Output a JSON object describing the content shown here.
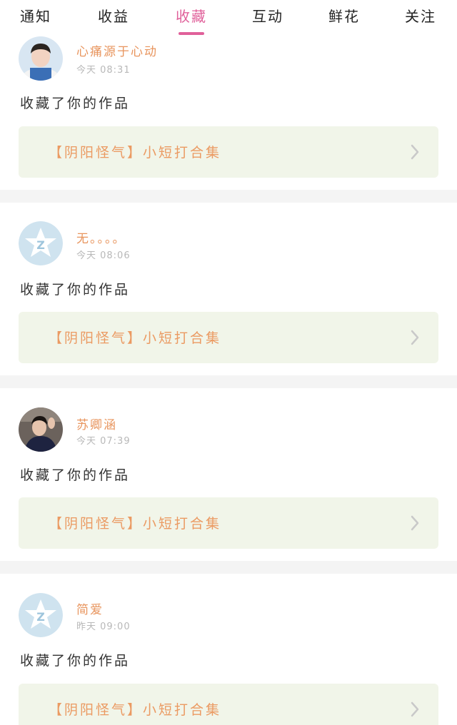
{
  "tabs": [
    {
      "label": "通知",
      "active": false
    },
    {
      "label": "收益",
      "active": false
    },
    {
      "label": "收藏",
      "active": true
    },
    {
      "label": "互动",
      "active": false
    },
    {
      "label": "鲜花",
      "active": false
    },
    {
      "label": "关注",
      "active": false
    }
  ],
  "colors": {
    "active_tab": "#e0609a",
    "username": "#e8955e",
    "work_title": "#eb9a62",
    "work_box_bg": "#f1f5e9",
    "default_avatar_bg": "#cfe3ef"
  },
  "notifications": [
    {
      "username": "心痛源于心动",
      "time": "今天 08:31",
      "avatar": "photo-avatar-boy",
      "action": "收藏了你的作品",
      "work_title": "【阴阳怪气】小短打合集"
    },
    {
      "username": "无。。。。",
      "time": "今天 08:06",
      "avatar": "default-star-avatar",
      "action": "收藏了你的作品",
      "work_title": "【阴阳怪气】小短打合集"
    },
    {
      "username": "苏卿涵",
      "time": "今天 07:39",
      "avatar": "photo-avatar-man",
      "action": "收藏了你的作品",
      "work_title": "【阴阳怪气】小短打合集"
    },
    {
      "username": "简爱",
      "time": "昨天 09:00",
      "avatar": "default-star-avatar",
      "action": "收藏了你的作品",
      "work_title": "【阴阳怪气】小短打合集"
    }
  ]
}
